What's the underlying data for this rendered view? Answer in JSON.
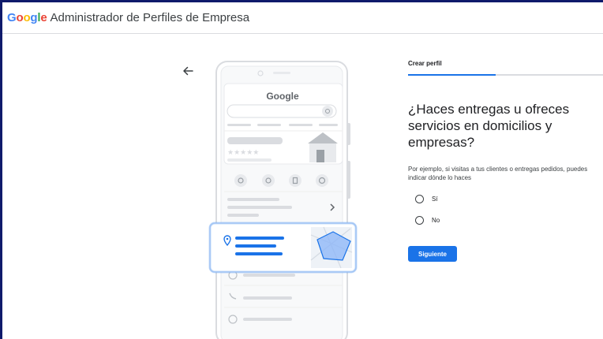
{
  "header": {
    "logo_letters": [
      "G",
      "o",
      "o",
      "g",
      "l",
      "e"
    ],
    "title": "Administrador de Perfiles de Empresa"
  },
  "illustration": {
    "phone_logo": "Google",
    "stars": "★★★★★"
  },
  "form": {
    "step_label": "Crear perfil",
    "progress": 0.45,
    "question": "¿Haces entregas u ofreces servicios en domicilios y empresas?",
    "help_text": "Por ejemplo, si visitas a tus clientes o entregas pedidos, puedes indicar dónde lo haces",
    "options": [
      {
        "label": "Sí"
      },
      {
        "label": "No"
      }
    ],
    "next_label": "Siguiente"
  },
  "colors": {
    "accent": "#1a73e8",
    "frame": "#0f1a6b",
    "illustration_blue": "#1a73e8"
  },
  "icons": [
    "back-arrow-icon",
    "phone-search-icon",
    "store-icon",
    "phone-icon",
    "target-icon",
    "bookmark-icon",
    "globe-icon",
    "chevron-right-icon",
    "location-pin-icon",
    "clock-icon"
  ]
}
